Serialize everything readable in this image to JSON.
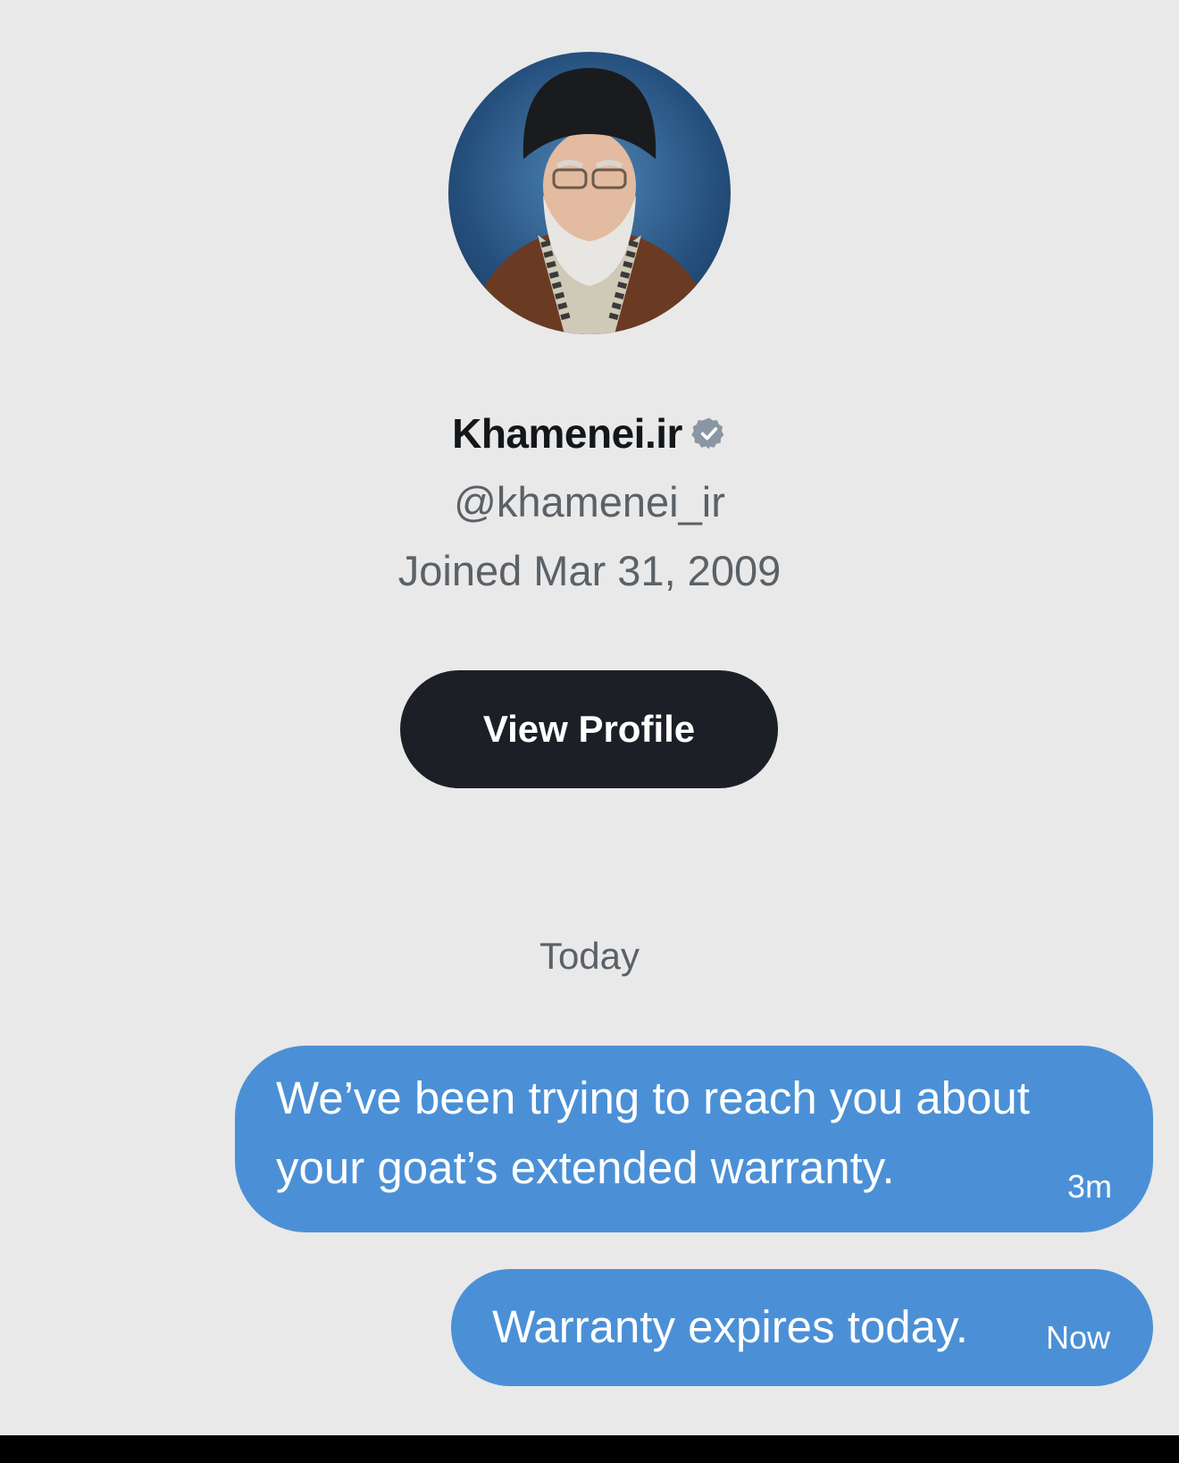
{
  "profile": {
    "avatar_icon": "profile-photo",
    "display_name": "Khamenei.ir",
    "verified_icon": "verified-badge-icon",
    "verified_color": "#8a96a3",
    "handle": "@khamenei_ir",
    "joined": "Joined Mar 31, 2009",
    "view_profile_label": "View Profile"
  },
  "conversation": {
    "date_separator": "Today",
    "messages": [
      {
        "text": "We’ve been trying to reach you about\nyour goat’s extended warranty.",
        "time": "3m"
      },
      {
        "text": "Warranty expires today.",
        "time": "Now"
      }
    ]
  },
  "colors": {
    "background": "#e9e9e9",
    "bubble": "#4b90d6",
    "button": "#1c1f26",
    "secondary_text": "#5b6167"
  }
}
